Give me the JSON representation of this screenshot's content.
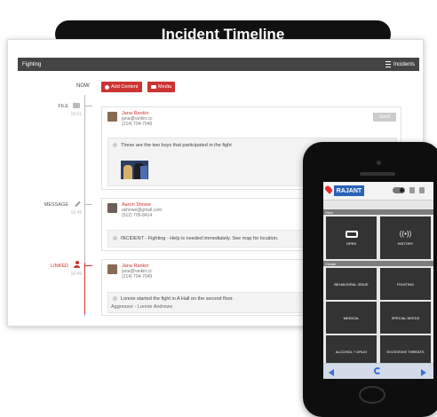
{
  "title": "Incident Timeline",
  "header": {
    "left": "Fighting",
    "right": "Incidents"
  },
  "timeline": {
    "now_label": "NOW",
    "add_content_label": "Add Content",
    "media_label": "Media",
    "entries": [
      {
        "type_label": "FILE",
        "time": "16:51",
        "name": "Jana Rankin",
        "email": "jana@rankin.cc",
        "phone": "(214) 704-7049",
        "send_label": "Send",
        "message": "These are the two boys that participated in the fight"
      },
      {
        "type_label": "MESSAGE",
        "time": "16:49",
        "name": "Aaron Showe",
        "email": "ashowe@gmail.com",
        "phone": "(512) 705-8414",
        "message": "INCIDENT - Fighting - Help is needed immediately. See map for location."
      },
      {
        "type_label": "LINKED",
        "time": "16:49",
        "name": "Jana Rankin",
        "email": "jana@rankin.cc",
        "phone": "(214) 704-7049",
        "message": "Lonnie started the fight in A Hall on the second floor.",
        "message2": "Aggressor - Lonnie Andrews"
      }
    ]
  },
  "phone": {
    "logo": "RAJANT",
    "section1": "View",
    "section2": "Create",
    "tiles_top": [
      "OPEN",
      "HISTORY"
    ],
    "tiles": [
      "BEHAVIORAL ISSUE",
      "FIGHTING",
      "MEDICAL",
      "SPECIAL NEEDS",
      "ALCOHOL + DRUG",
      "EXCESSIVE THREATS"
    ]
  },
  "colors": {
    "accent": "#cc3333",
    "header_bg": "#444444",
    "phone_blue": "#2a63b8"
  }
}
